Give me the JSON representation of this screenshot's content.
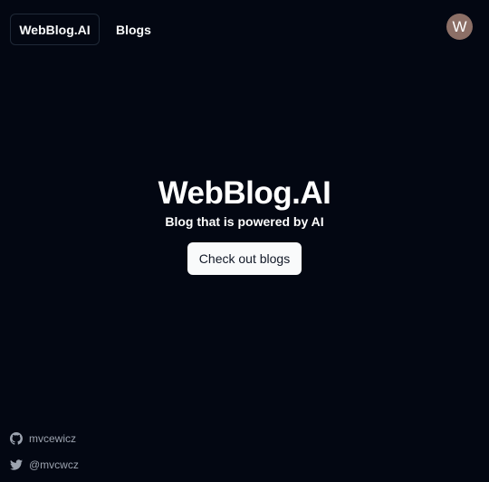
{
  "header": {
    "home_label": "WebBlog.AI",
    "blogs_label": "Blogs",
    "avatar_initial": "W"
  },
  "hero": {
    "title": "WebBlog.AI",
    "subtitle": "Blog that is powered by AI",
    "cta_label": "Check out blogs"
  },
  "footer": {
    "links": [
      {
        "icon": "github-icon",
        "label": "mvcewicz"
      },
      {
        "icon": "twitter-icon",
        "label": "@mvcwcz"
      }
    ]
  },
  "colors": {
    "background": "#030712",
    "text": "#f9fafb",
    "muted": "#9ca3af",
    "avatar": "#8c6f66",
    "button_bg": "#f9fafb"
  }
}
